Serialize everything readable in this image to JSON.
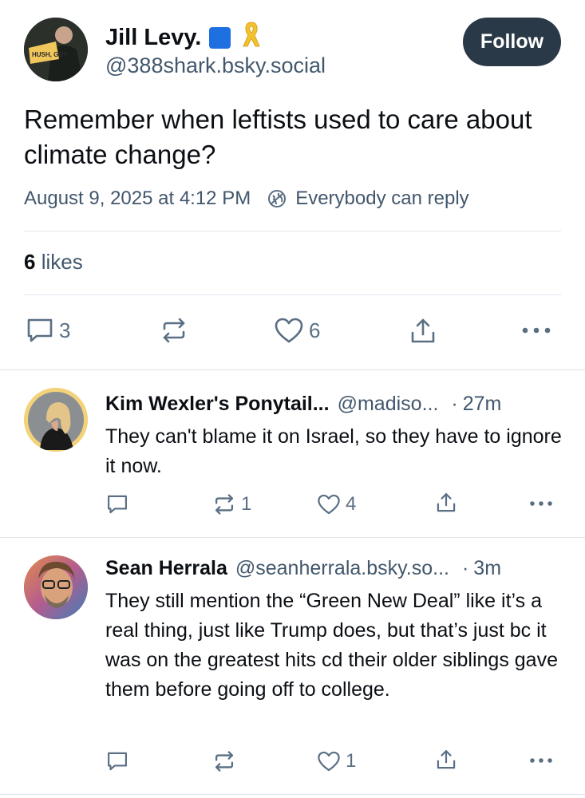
{
  "post": {
    "author_name": "Jill Levy.",
    "author_handle": "@388shark.bsky.social",
    "avatar_text": "HUSH, GOY",
    "follow_label": "Follow",
    "text": "Remember when leftists used to care about climate change?",
    "timestamp": "August 9, 2025 at 4:12 PM",
    "reply_setting": "Everybody can reply",
    "likes_count": "6",
    "likes_label": "likes",
    "actions": {
      "reply_count": "3",
      "repost_count": "",
      "like_count": "6"
    }
  },
  "replies": [
    {
      "name": "Kim Wexler's Ponytail...",
      "handle": "@madiso...",
      "separator": "·",
      "time": "27m",
      "text": "They can't blame it on Israel, so they have to ignore it now.",
      "reply_count": "",
      "repost_count": "1",
      "like_count": "4"
    },
    {
      "name": "Sean Herrala",
      "handle": "@seanherrala.bsky.so...",
      "separator": "·",
      "time": "3m",
      "text": "They still mention the “Green New Deal” like it’s a real thing, just like Trump does, but that’s just bc it was on the greatest hits cd their older siblings gave them before going off to college.",
      "reply_count": "",
      "repost_count": "",
      "like_count": "1"
    }
  ],
  "icons": {
    "reply": "speech-bubble-icon",
    "repost": "repost-arrows-icon",
    "like": "heart-outline-icon",
    "share": "share-upload-icon",
    "more": "ellipsis-icon",
    "reply_setting": "globe-slash-icon",
    "badge_square": "blue-square-emoji",
    "badge_ribbon": "yellow-ribbon-emoji"
  },
  "colors": {
    "follow_button_bg": "#2a3947",
    "muted_text": "#42576c",
    "icon_gray": "#5a6f84",
    "divider": "#dfe4ea",
    "blue_square": "#1e6fe0",
    "ribbon_yellow": "#f2c230"
  }
}
